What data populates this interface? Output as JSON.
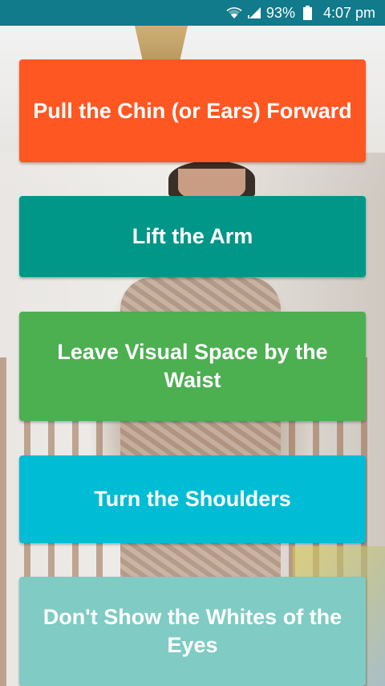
{
  "status_bar": {
    "battery_percent": "93%",
    "time": "4:07 pm",
    "icons": [
      "wifi-icon",
      "signal-icon",
      "battery-icon"
    ],
    "background_color": "#117a8b"
  },
  "buttons": [
    {
      "label": "Pull the Chin (or Ears) Forward",
      "color": "#ff5722"
    },
    {
      "label": "Lift the Arm",
      "color": "#009688"
    },
    {
      "label": "Leave Visual Space by the Waist",
      "color": "#4caf50"
    },
    {
      "label": "Turn the Shoulders",
      "color": "#00bcd4"
    },
    {
      "label": "Don't Show the Whites of the Eyes",
      "color": "#80cbc4"
    }
  ]
}
